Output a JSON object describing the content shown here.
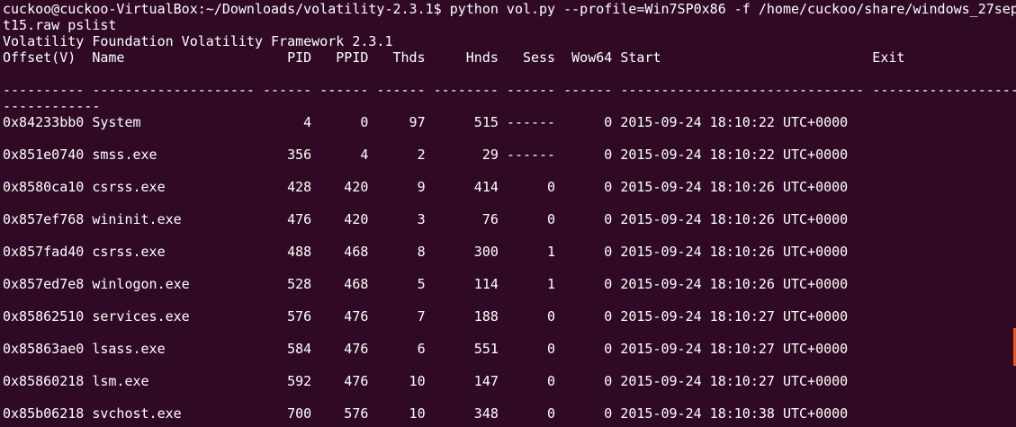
{
  "terminal": {
    "prompt_line_1": "cuckoo@cuckoo-VirtualBox:~/Downloads/volatility-2.3.1$ python vol.py --profile=Win7SP0x86 -f /home/cuckoo/share/windows_27sep",
    "prompt_line_2": "t15.raw pslist",
    "banner": "Volatility Foundation Volatility Framework 2.3.1",
    "header": "Offset(V)  Name                    PID   PPID   Thds     Hnds   Sess  Wow64 Start                          Exit",
    "separator_1": "---------- -------------------- ------ ------ ------ -------- ------ ------ ------------------------------ ------------------",
    "separator_2": "------------",
    "rows": [
      "0x84233bb0 System                    4      0     97      515 ------      0 2015-09-24 18:10:22 UTC+0000",
      "0x851e0740 smss.exe                356      4      2       29 ------      0 2015-09-24 18:10:22 UTC+0000",
      "0x8580ca10 csrss.exe               428    420      9      414      0      0 2015-09-24 18:10:26 UTC+0000",
      "0x857ef768 wininit.exe             476    420      3       76      0      0 2015-09-24 18:10:26 UTC+0000",
      "0x857fad40 csrss.exe               488    468      8      300      1      0 2015-09-24 18:10:26 UTC+0000",
      "0x857ed7e8 winlogon.exe            528    468      5      114      1      0 2015-09-24 18:10:26 UTC+0000",
      "0x85862510 services.exe            576    476      7      188      0      0 2015-09-24 18:10:27 UTC+0000",
      "0x85863ae0 lsass.exe               584    476      6      551      0      0 2015-09-24 18:10:27 UTC+0000",
      "0x85860218 lsm.exe                 592    476     10      147      0      0 2015-09-24 18:10:27 UTC+0000",
      "0x85b06218 svchost.exe             700    576     10      348      0      0 2015-09-24 18:10:38 UTC+0000"
    ]
  },
  "colors": {
    "background": "#300a24",
    "text": "#ffffff",
    "scroll_indicator": "#e95420"
  }
}
